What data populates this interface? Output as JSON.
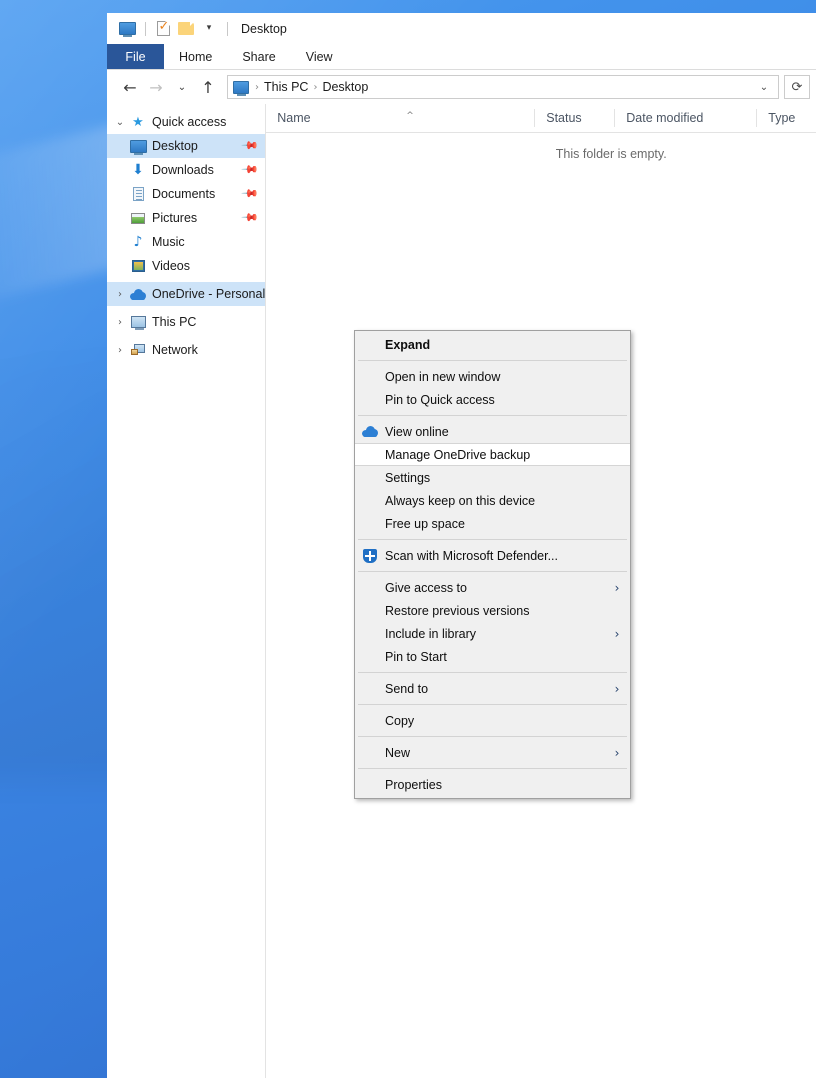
{
  "desktop": {
    "accent": "#3b84e2"
  },
  "window": {
    "title": "Desktop",
    "quick_access_toolbar": [
      {
        "name": "desktop-icon",
        "icon": "monitor-icon"
      },
      {
        "name": "properties-icon",
        "icon": "properties-checkbox-icon"
      },
      {
        "name": "new-folder-icon",
        "icon": "folder-icon"
      },
      {
        "name": "customize-qat",
        "icon": "caret-down-icon"
      }
    ],
    "ribbon_tabs": [
      {
        "label": "File",
        "active": true
      },
      {
        "label": "Home",
        "active": false
      },
      {
        "label": "Share",
        "active": false
      },
      {
        "label": "View",
        "active": false
      }
    ],
    "navigation": {
      "back_icon": "arrow-left-icon",
      "forward_icon": "arrow-right-icon",
      "recent_icon": "chevron-down-icon",
      "up_icon": "arrow-up-icon",
      "breadcrumb": [
        "This PC",
        "Desktop"
      ],
      "breadcrumb_separator": "›",
      "dropdown_icon": "chevron-down-icon",
      "refresh_icon": "refresh-icon"
    }
  },
  "sidebar": {
    "items": [
      {
        "label": "Quick access",
        "icon": "star-icon",
        "twisty": "⌄",
        "indent": false,
        "pinned": false,
        "selected": false
      },
      {
        "label": "Desktop",
        "icon": "monitor-icon",
        "twisty": "",
        "indent": true,
        "pinned": true,
        "selected": true
      },
      {
        "label": "Downloads",
        "icon": "download-arrow-icon",
        "twisty": "",
        "indent": true,
        "pinned": true,
        "selected": false
      },
      {
        "label": "Documents",
        "icon": "document-icon",
        "twisty": "",
        "indent": true,
        "pinned": true,
        "selected": false
      },
      {
        "label": "Pictures",
        "icon": "picture-icon",
        "twisty": "",
        "indent": true,
        "pinned": true,
        "selected": false
      },
      {
        "label": "Music",
        "icon": "music-note-icon",
        "twisty": "",
        "indent": true,
        "pinned": false,
        "selected": false
      },
      {
        "label": "Videos",
        "icon": "video-icon",
        "twisty": "",
        "indent": true,
        "pinned": false,
        "selected": false
      },
      {
        "label": "OneDrive - Personal",
        "icon": "cloud-icon",
        "twisty": "›",
        "indent": false,
        "pinned": false,
        "selected": true
      },
      {
        "label": "This PC",
        "icon": "this-pc-icon",
        "twisty": "›",
        "indent": false,
        "pinned": false,
        "selected": false
      },
      {
        "label": "Network",
        "icon": "network-icon",
        "twisty": "›",
        "indent": false,
        "pinned": false,
        "selected": false
      }
    ]
  },
  "file_list": {
    "columns": [
      {
        "label": "Name",
        "sorted": true,
        "sort_caret": "^"
      },
      {
        "label": "Status",
        "sorted": false,
        "sort_caret": ""
      },
      {
        "label": "Date modified",
        "sorted": false,
        "sort_caret": ""
      },
      {
        "label": "Type",
        "sorted": false,
        "sort_caret": ""
      }
    ],
    "empty_message": "This folder is empty.",
    "rows": []
  },
  "context_menu": {
    "items": [
      {
        "label": "Expand",
        "bold": true,
        "icon": "",
        "arrow": "",
        "highlighted": false,
        "separator_after": true
      },
      {
        "label": "Open in new window",
        "bold": false,
        "icon": "",
        "arrow": "",
        "highlighted": false,
        "separator_after": false
      },
      {
        "label": "Pin to Quick access",
        "bold": false,
        "icon": "",
        "arrow": "",
        "highlighted": false,
        "separator_after": true
      },
      {
        "label": "View online",
        "bold": false,
        "icon": "cloud-icon",
        "arrow": "",
        "highlighted": false,
        "separator_after": false
      },
      {
        "label": "Manage OneDrive backup",
        "bold": false,
        "icon": "",
        "arrow": "",
        "highlighted": true,
        "separator_after": false
      },
      {
        "label": "Settings",
        "bold": false,
        "icon": "",
        "arrow": "",
        "highlighted": false,
        "separator_after": false
      },
      {
        "label": "Always keep on this device",
        "bold": false,
        "icon": "",
        "arrow": "",
        "highlighted": false,
        "separator_after": false
      },
      {
        "label": "Free up space",
        "bold": false,
        "icon": "",
        "arrow": "",
        "highlighted": false,
        "separator_after": true
      },
      {
        "label": "Scan with Microsoft Defender...",
        "bold": false,
        "icon": "shield-icon",
        "arrow": "",
        "highlighted": false,
        "separator_after": true
      },
      {
        "label": "Give access to",
        "bold": false,
        "icon": "",
        "arrow": "›",
        "highlighted": false,
        "separator_after": false
      },
      {
        "label": "Restore previous versions",
        "bold": false,
        "icon": "",
        "arrow": "",
        "highlighted": false,
        "separator_after": false
      },
      {
        "label": "Include in library",
        "bold": false,
        "icon": "",
        "arrow": "›",
        "highlighted": false,
        "separator_after": false
      },
      {
        "label": "Pin to Start",
        "bold": false,
        "icon": "",
        "arrow": "",
        "highlighted": false,
        "separator_after": true
      },
      {
        "label": "Send to",
        "bold": false,
        "icon": "",
        "arrow": "›",
        "highlighted": false,
        "separator_after": true
      },
      {
        "label": "Copy",
        "bold": false,
        "icon": "",
        "arrow": "",
        "highlighted": false,
        "separator_after": true
      },
      {
        "label": "New",
        "bold": false,
        "icon": "",
        "arrow": "›",
        "highlighted": false,
        "separator_after": true
      },
      {
        "label": "Properties",
        "bold": false,
        "icon": "",
        "arrow": "",
        "highlighted": false,
        "separator_after": false
      }
    ]
  }
}
